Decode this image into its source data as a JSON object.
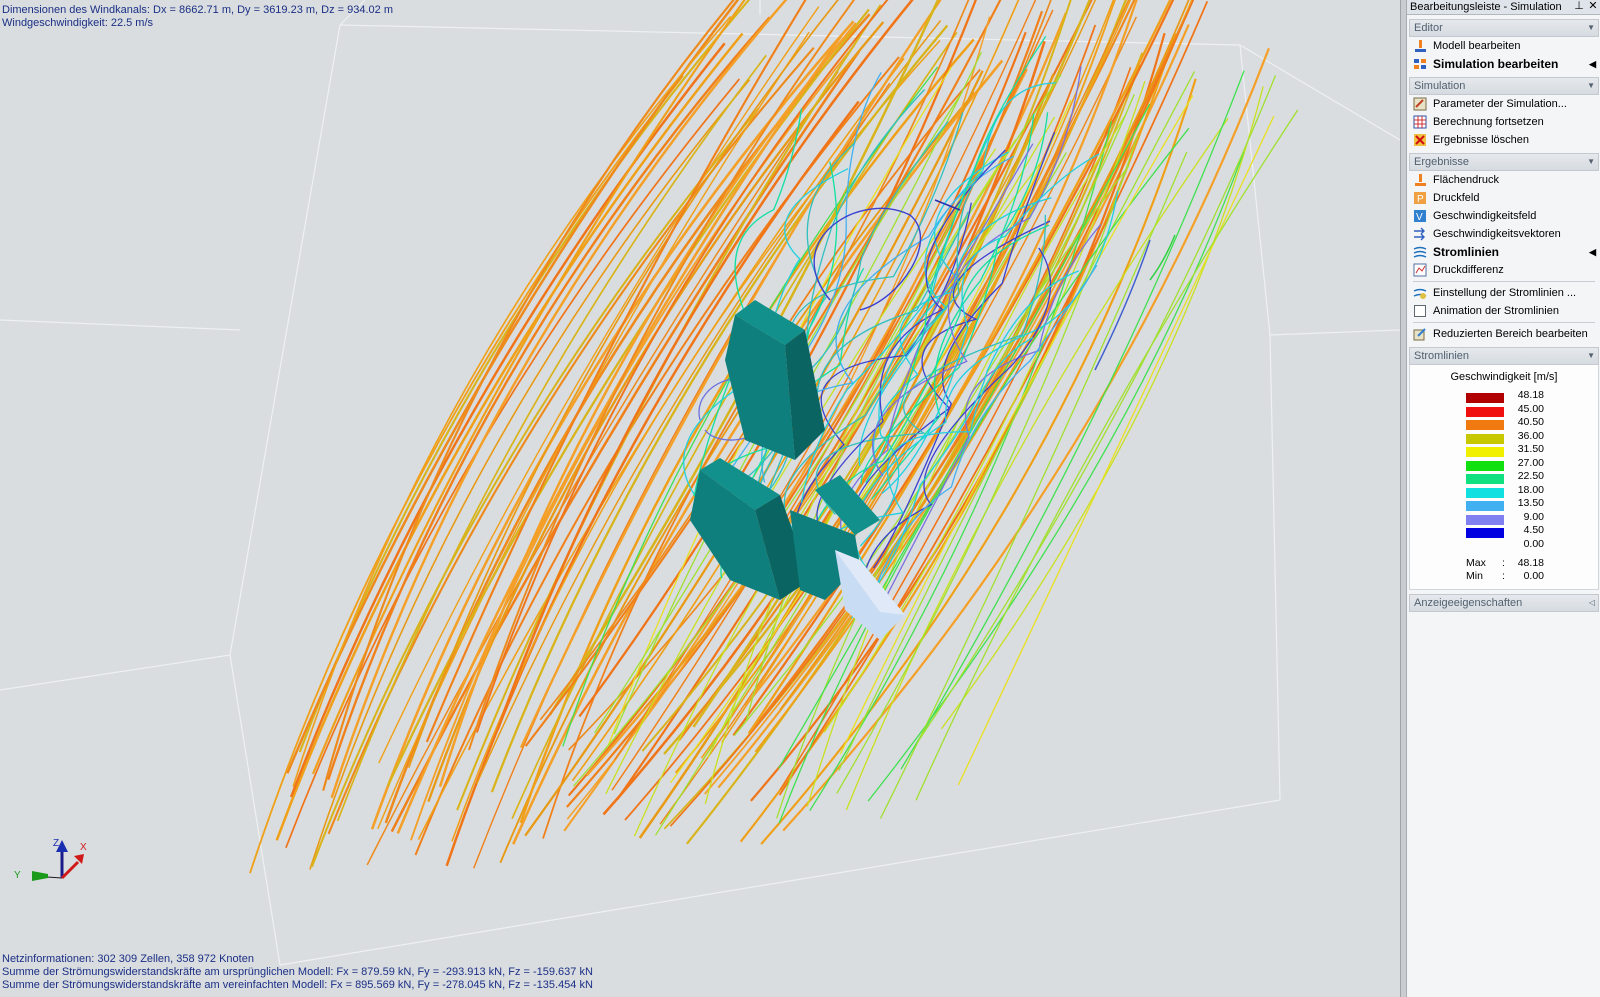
{
  "viewport": {
    "info_top": [
      "Dimensionen des Windkanals: Dx = 8662.71 m, Dy = 3619.23 m, Dz = 934.02 m",
      "Windgeschwindigkeit: 22.5 m/s"
    ],
    "info_bottom": [
      "Netzinformationen: 302 309 Zellen, 358 972 Knoten",
      "Summe der Strömungswiderstandskräfte am ursprünglichen Modell: Fx = 879.59 kN, Fy = -293.913 kN, Fz = -159.637 kN",
      "Summe der Strömungswiderstandskräfte am vereinfachten Modell: Fx = 895.569 kN, Fy = -278.045 kN, Fz = -135.454 kN"
    ],
    "axes": {
      "x": "X",
      "y": "Y",
      "z": "Z"
    }
  },
  "panel": {
    "title": "Bearbeitungsleiste - Simulation",
    "pin_glyph": "⊥",
    "close_glyph": "✕",
    "sections": {
      "editor": {
        "label": "Editor",
        "items": [
          "Modell bearbeiten",
          "Simulation bearbeiten"
        ]
      },
      "simulation": {
        "label": "Simulation",
        "items": [
          "Parameter der Simulation...",
          "Berechnung fortsetzen",
          "Ergebnisse löschen"
        ]
      },
      "ergebnisse": {
        "label": "Ergebnisse",
        "items": [
          "Flächendruck",
          "Druckfeld",
          "Geschwindigkeitsfeld",
          "Geschwindigkeitsvektoren",
          "Stromlinien",
          "Druckdifferenz",
          "Einstellung der Stromlinien ...",
          "Animation der Stromlinien",
          "Reduzierten Bereich bearbeiten"
        ]
      },
      "stromlinien": {
        "label": "Stromlinien"
      },
      "anzeige": {
        "label": "Anzeigeeigenschaften"
      }
    },
    "legend": {
      "title": "Geschwindigkeit [m/s]",
      "values": [
        "48.18",
        "45.00",
        "40.50",
        "36.00",
        "31.50",
        "27.00",
        "22.50",
        "18.00",
        "13.50",
        "9.00",
        "4.50",
        "0.00"
      ],
      "colors": [
        "#b00000",
        "#f01010",
        "#f07a10",
        "#c8c800",
        "#f0f000",
        "#10e010",
        "#10e080",
        "#10e0e0",
        "#40b0f0",
        "#8080f0",
        "#0000e0"
      ],
      "max_label": "Max",
      "min_label": "Min",
      "sep": ":",
      "max_value": "48.18",
      "min_value": "0.00"
    }
  }
}
